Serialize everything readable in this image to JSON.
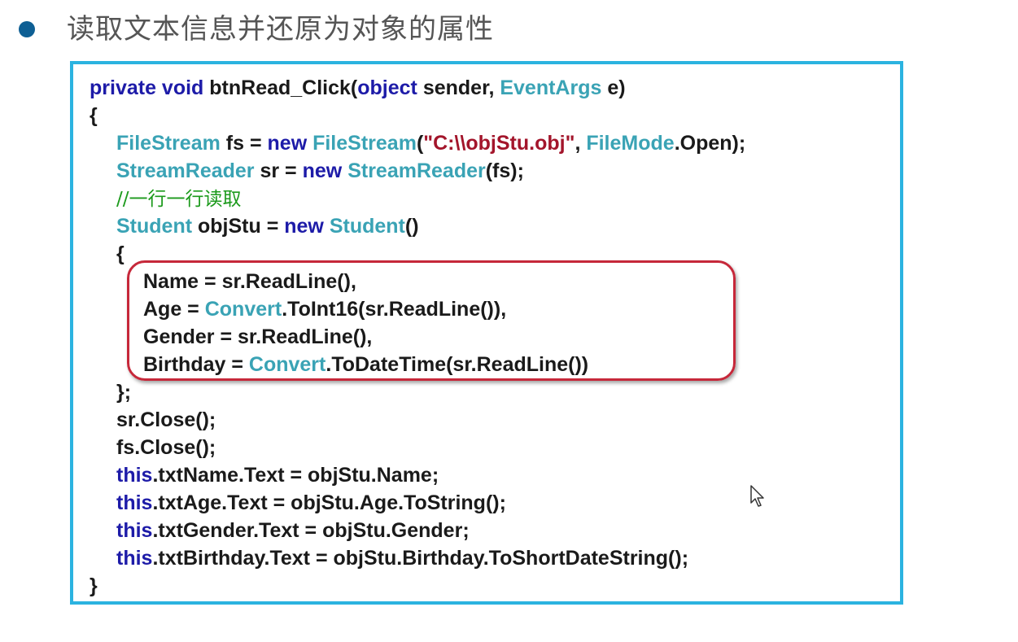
{
  "heading": "读取文本信息并还原为对象的属性",
  "code": {
    "l1": {
      "kw1": "private void",
      "t1": " btnRead_Click(",
      "kw2": "object",
      "t2": " sender, ",
      "tp1": "EventArgs",
      "t3": " e)"
    },
    "l2": "{",
    "l3": {
      "tp1": "FileStream",
      "t1": " fs = ",
      "kw1": "new",
      "sp": " ",
      "tp2": "FileStream",
      "t2": "(",
      "str1": "\"C:\\\\objStu.obj\"",
      "t3": ", ",
      "tp3": "FileMode",
      "t4": ".Open);"
    },
    "l4": {
      "tp1": "StreamReader",
      "t1": " sr = ",
      "kw1": "new",
      "sp": " ",
      "tp2": "StreamReader",
      "t2": "(fs);"
    },
    "l5": "//一行一行读取",
    "l6": {
      "tp1": "Student",
      "t1": " objStu = ",
      "kw1": "new",
      "sp": " ",
      "tp2": "Student",
      "t2": "()"
    },
    "l7": "{",
    "l8": "Name = sr.ReadLine(),",
    "l9": {
      "t1": "Age = ",
      "tp1": "Convert",
      "t2": ".ToInt16(sr.ReadLine()),"
    },
    "l10": "Gender = sr.ReadLine(),",
    "l11": {
      "t1": "Birthday = ",
      "tp1": "Convert",
      "t2": ".ToDateTime(sr.ReadLine())"
    },
    "l12": "};",
    "l13": "sr.Close();",
    "l14": "fs.Close();",
    "l15": {
      "kw1": "this",
      "t1": ".txtName.Text = objStu.Name;"
    },
    "l16": {
      "kw1": "this",
      "t1": ".txtAge.Text = objStu.Age.ToString();"
    },
    "l17": {
      "kw1": "this",
      "t1": ".txtGender.Text = objStu.Gender;"
    },
    "l18": {
      "kw1": "this",
      "t1": ".txtBirthday.Text = objStu.Birthday.ToShortDateString();"
    },
    "l19": "}"
  },
  "colors": {
    "keyword": "#1d1ba8",
    "type": "#3aa3b5",
    "string": "#a3152b",
    "comment": "#1c9a1c",
    "frame_border": "#2bb3e0",
    "highlight_border": "#c6283a",
    "bullet": "#0e5f94"
  },
  "icons": {
    "bullet": "bullet-dot-icon",
    "cursor": "mouse-pointer-icon"
  }
}
